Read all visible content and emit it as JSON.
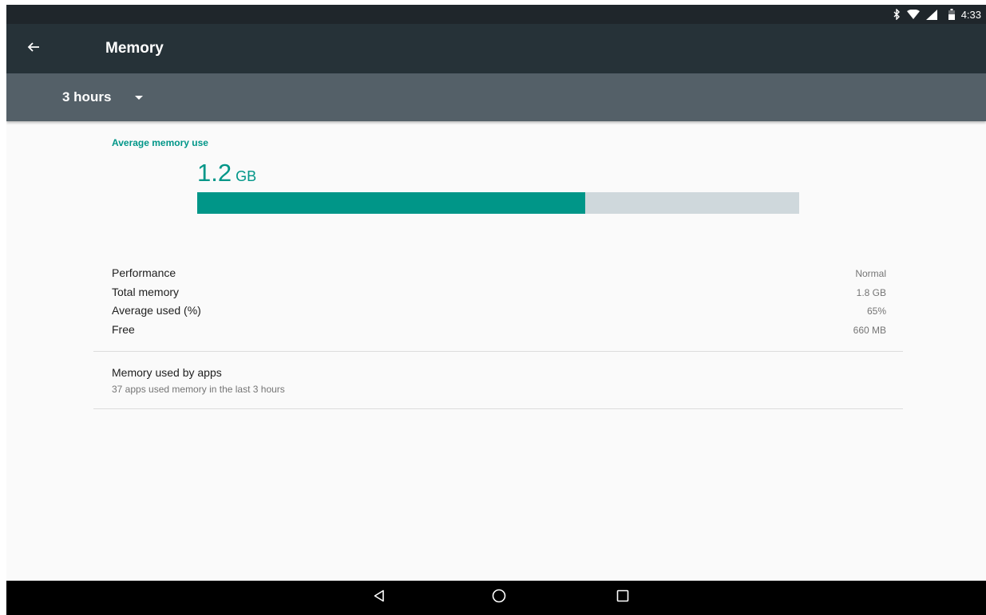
{
  "status_bar": {
    "time": "4:33",
    "icons": [
      "bluetooth-icon",
      "wifi-icon",
      "signal-icon",
      "battery-icon"
    ]
  },
  "app_bar": {
    "title": "Memory",
    "back_icon": "arrow-back-icon"
  },
  "period_spinner": {
    "selected": "3 hours",
    "icon": "dropdown-arrow-icon"
  },
  "summary": {
    "title": "Average memory use",
    "value": "1.2",
    "unit": "GB",
    "usage_fraction": 0.645
  },
  "stats": [
    {
      "label": "Performance",
      "value": "Normal"
    },
    {
      "label": "Total memory",
      "value": "1.8 GB"
    },
    {
      "label": "Average used (%)",
      "value": "65%"
    },
    {
      "label": "Free",
      "value": "660 MB"
    }
  ],
  "apps_item": {
    "title": "Memory used by apps",
    "subtitle": "37 apps used memory in the last 3 hours"
  },
  "nav_bar": {
    "icons": [
      "back-triangle-icon",
      "home-circle-icon",
      "recents-square-icon"
    ]
  },
  "colors": {
    "accent": "#009688",
    "app_bar": "#263238",
    "filter_bar": "#546068",
    "bar_track": "#cfd8dc"
  }
}
